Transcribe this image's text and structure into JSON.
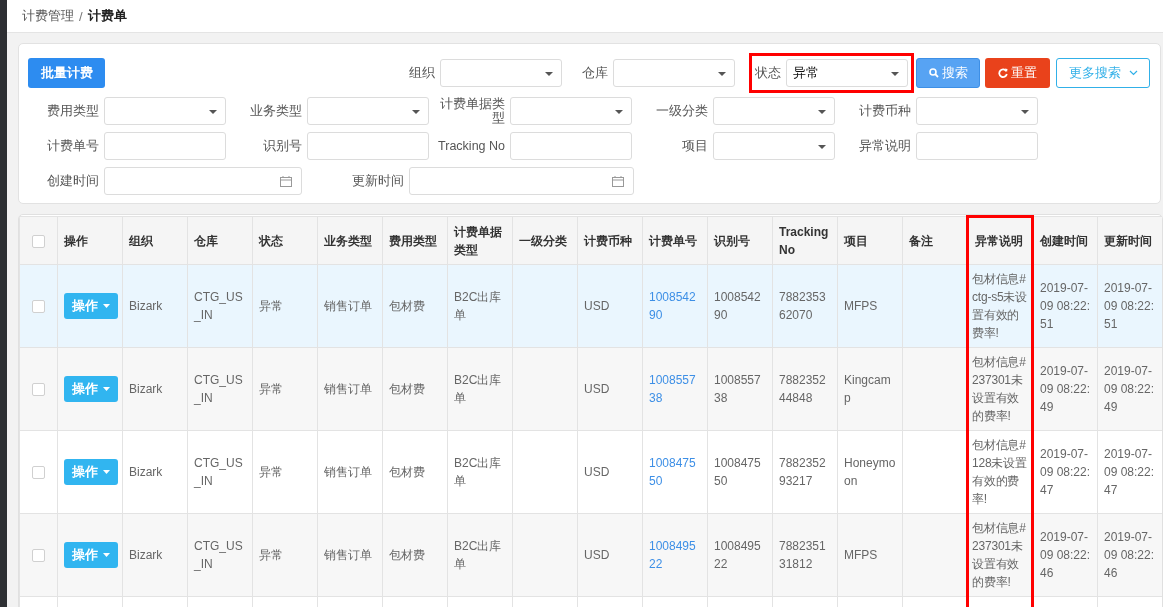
{
  "breadcrumb": [
    {
      "label": "计费管理",
      "current": false
    },
    {
      "label": "计费单",
      "current": true
    }
  ],
  "breadcrumb_separator": "/",
  "batch_button": "批量计费",
  "top_filters": [
    {
      "label": "组织",
      "kind": "select",
      "highlighted": false
    },
    {
      "label": "仓库",
      "kind": "select",
      "highlighted": false
    },
    {
      "label": "状态",
      "kind": "select",
      "value": "异常",
      "highlighted": true
    }
  ],
  "actions": [
    {
      "label": "搜索",
      "kind": "search"
    },
    {
      "label": "重置",
      "kind": "reset"
    },
    {
      "label": "更多搜索",
      "kind": "more"
    }
  ],
  "filter_rows": [
    [
      {
        "label": "费用类型",
        "kind": "select"
      },
      {
        "label": "业务类型",
        "kind": "select"
      },
      {
        "label": "计费单据类型",
        "kind": "select"
      },
      {
        "label": "一级分类",
        "kind": "select"
      },
      {
        "label": "计费币种",
        "kind": "select"
      }
    ],
    [
      {
        "label": "计费单号",
        "kind": "text"
      },
      {
        "label": "识别号",
        "kind": "text"
      },
      {
        "label": "Tracking No",
        "kind": "text"
      },
      {
        "label": "项目",
        "kind": "select"
      },
      {
        "label": "异常说明",
        "kind": "text"
      }
    ],
    [
      {
        "label": "创建时间",
        "kind": "date"
      },
      {
        "label": "更新时间",
        "kind": "date"
      }
    ]
  ],
  "table": {
    "select_all": {
      "checked": false
    },
    "columns": [
      {
        "label": "操作",
        "kind": "button",
        "highlighted": false
      },
      {
        "label": "组织",
        "kind": "text",
        "highlighted": false
      },
      {
        "label": "仓库",
        "kind": "text",
        "highlighted": false
      },
      {
        "label": "状态",
        "kind": "text",
        "highlighted": false
      },
      {
        "label": "业务类型",
        "kind": "text",
        "highlighted": false
      },
      {
        "label": "费用类型",
        "kind": "text",
        "highlighted": false
      },
      {
        "label": "计费单据类型",
        "kind": "text",
        "highlighted": false
      },
      {
        "label": "一级分类",
        "kind": "text",
        "highlighted": false
      },
      {
        "label": "计费币种",
        "kind": "text",
        "highlighted": false
      },
      {
        "label": "计费单号",
        "kind": "link",
        "highlighted": false
      },
      {
        "label": "识别号",
        "kind": "text",
        "highlighted": false
      },
      {
        "label": "Tracking No",
        "kind": "text",
        "highlighted": false
      },
      {
        "label": "项目",
        "kind": "text",
        "highlighted": false
      },
      {
        "label": "备注",
        "kind": "text",
        "highlighted": false
      },
      {
        "label": "异常说明",
        "kind": "text",
        "highlighted": true
      },
      {
        "label": "创建时间",
        "kind": "text",
        "highlighted": false
      },
      {
        "label": "更新时间",
        "kind": "text",
        "highlighted": false
      }
    ],
    "rows": [
      {
        "selected": true,
        "checked": false,
        "cells": [
          "操作",
          "Bizark",
          "CTG_US_IN",
          "异常",
          "销售订单",
          "包材费",
          "B2C出库单",
          null,
          "USD",
          "100854290",
          "100854290",
          "788235362070",
          "MFPS",
          null,
          "包材信息#ctg-s5未设置有效的费率!",
          "2019-07-09 08:22:51",
          "2019-07-09 08:22:51"
        ]
      },
      {
        "selected": false,
        "checked": false,
        "cells": [
          "操作",
          "Bizark",
          "CTG_US_IN",
          "异常",
          "销售订单",
          "包材费",
          "B2C出库单",
          null,
          "USD",
          "100855738",
          "100855738",
          "788235244848",
          "Kingcamp",
          null,
          "包材信息#237301未设置有效的费率!",
          "2019-07-09 08:22:49",
          "2019-07-09 08:22:49"
        ]
      },
      {
        "selected": false,
        "checked": false,
        "cells": [
          "操作",
          "Bizark",
          "CTG_US_IN",
          "异常",
          "销售订单",
          "包材费",
          "B2C出库单",
          null,
          "USD",
          "100847550",
          "100847550",
          "788235293217",
          "Honeymoon",
          null,
          "包材信息#128未设置有效的费率!",
          "2019-07-09 08:22:47",
          "2019-07-09 08:22:47"
        ]
      },
      {
        "selected": false,
        "checked": false,
        "cells": [
          "操作",
          "Bizark",
          "CTG_US_IN",
          "异常",
          "销售订单",
          "包材费",
          "B2C出库单",
          null,
          "USD",
          "100849522",
          "100849522",
          "788235131812",
          "MFPS",
          null,
          "包材信息#237301未设置有效的费率!",
          "2019-07-09 08:22:46",
          "2019-07-09 08:22:46"
        ]
      }
    ]
  }
}
